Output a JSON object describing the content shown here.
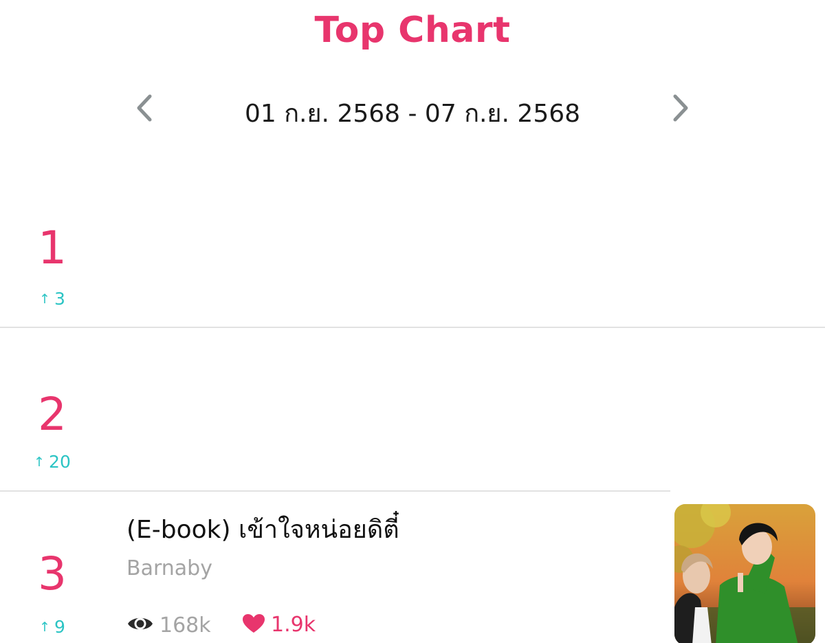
{
  "header": {
    "title": "Top Chart",
    "date_range": "01 ก.ย. 2568 - 07 ก.ย. 2568",
    "prev_icon": "chevron-left-icon",
    "next_icon": "chevron-right-icon"
  },
  "accent_color": "#e8356d",
  "rank_change_color": "#2bc4c4",
  "chart_items": [
    {
      "rank": "1",
      "change": "3",
      "change_direction": "up",
      "title": "",
      "author": ""
    },
    {
      "rank": "2",
      "change": "20",
      "change_direction": "up",
      "title": "",
      "author": ""
    },
    {
      "rank": "3",
      "change": "9",
      "change_direction": "up",
      "title": "(E-book) เข้าใจหน่อยดิตี๋",
      "author": "Barnaby",
      "views": "168k",
      "likes": "1.9k",
      "views_icon": "eye-icon",
      "likes_icon": "heart-icon",
      "cover": "book-cover-image"
    }
  ]
}
